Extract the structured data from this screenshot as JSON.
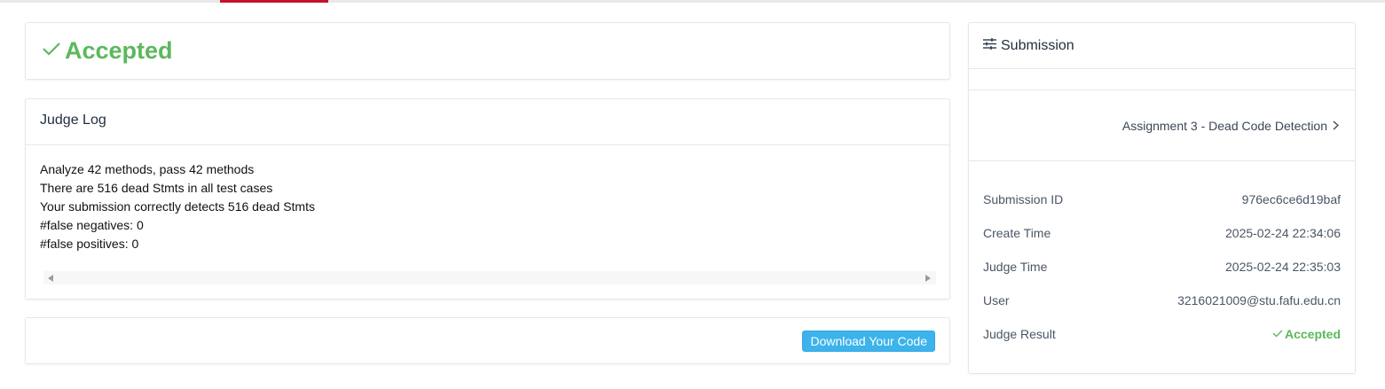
{
  "status": {
    "label": "Accepted",
    "color": "#5cb85c",
    "icon": "check-icon"
  },
  "judge_log": {
    "title": "Judge Log",
    "lines": [
      "Analyze 42 methods, pass 42 methods",
      "There are 516 dead Stmts in all test cases",
      "Your submission correctly detects 516 dead Stmts",
      "#false negatives: 0",
      "#false positives: 0"
    ]
  },
  "download": {
    "label": "Download Your Code",
    "color": "#3cb3ec"
  },
  "submission": {
    "title": "Submission",
    "icon": "sliders-icon",
    "assignment": "Assignment 3 - Dead Code Detection",
    "fields": [
      {
        "label": "Submission ID",
        "value": "976ec6ce6d19baf"
      },
      {
        "label": "Create Time",
        "value": "2025-02-24 22:34:06"
      },
      {
        "label": "Judge Time",
        "value": "2025-02-24 22:35:03"
      },
      {
        "label": "User",
        "value": "3216021009@stu.fafu.edu.cn"
      }
    ],
    "result_label": "Judge Result",
    "result_value": "Accepted"
  }
}
